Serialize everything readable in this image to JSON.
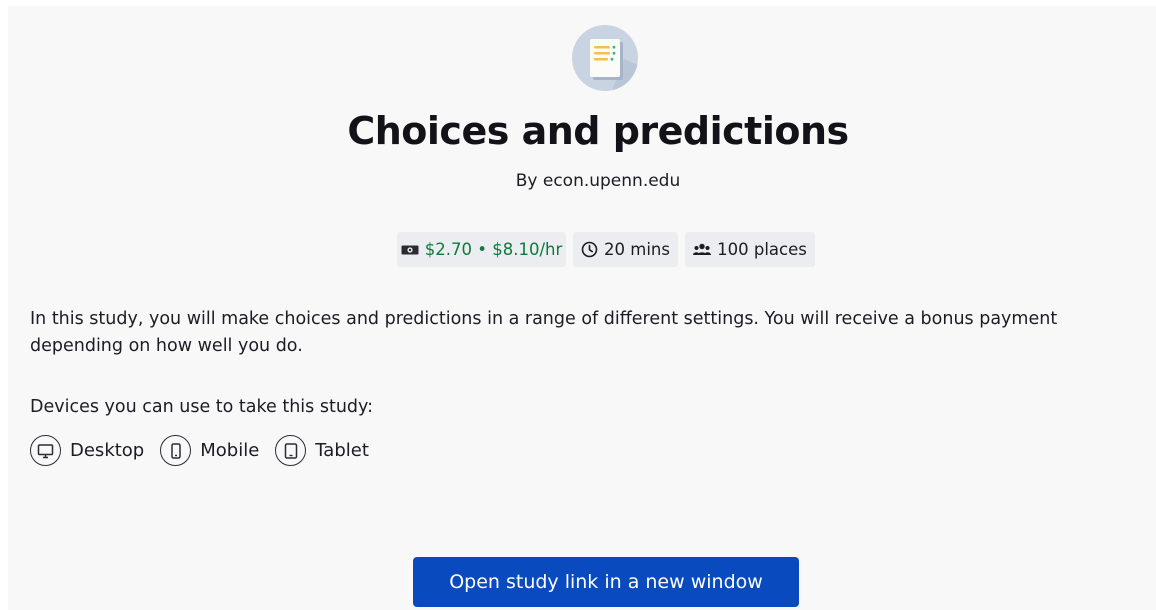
{
  "study": {
    "title": "Choices and predictions",
    "byline": "By econ.upenn.edu",
    "icon": "document-icon"
  },
  "stats": {
    "reward": "$2.70 • $8.10/hr",
    "reward_icon": "money-icon",
    "reward_color": "#0e7a3c",
    "duration": "20 mins",
    "duration_icon": "clock-icon",
    "places": "100 places",
    "places_icon": "people-icon"
  },
  "description": "In this study, you will make choices and predictions in a range of different settings. You will receive a bonus payment depending on how well you do.",
  "devices": {
    "label": "Devices you can use to take this study:",
    "items": [
      {
        "label": "Desktop",
        "icon": "desktop-icon"
      },
      {
        "label": "Mobile",
        "icon": "mobile-icon"
      },
      {
        "label": "Tablet",
        "icon": "tablet-icon"
      }
    ]
  },
  "actions": {
    "open_link_label": "Open study link in a new window",
    "button_color": "#0a4abf"
  }
}
